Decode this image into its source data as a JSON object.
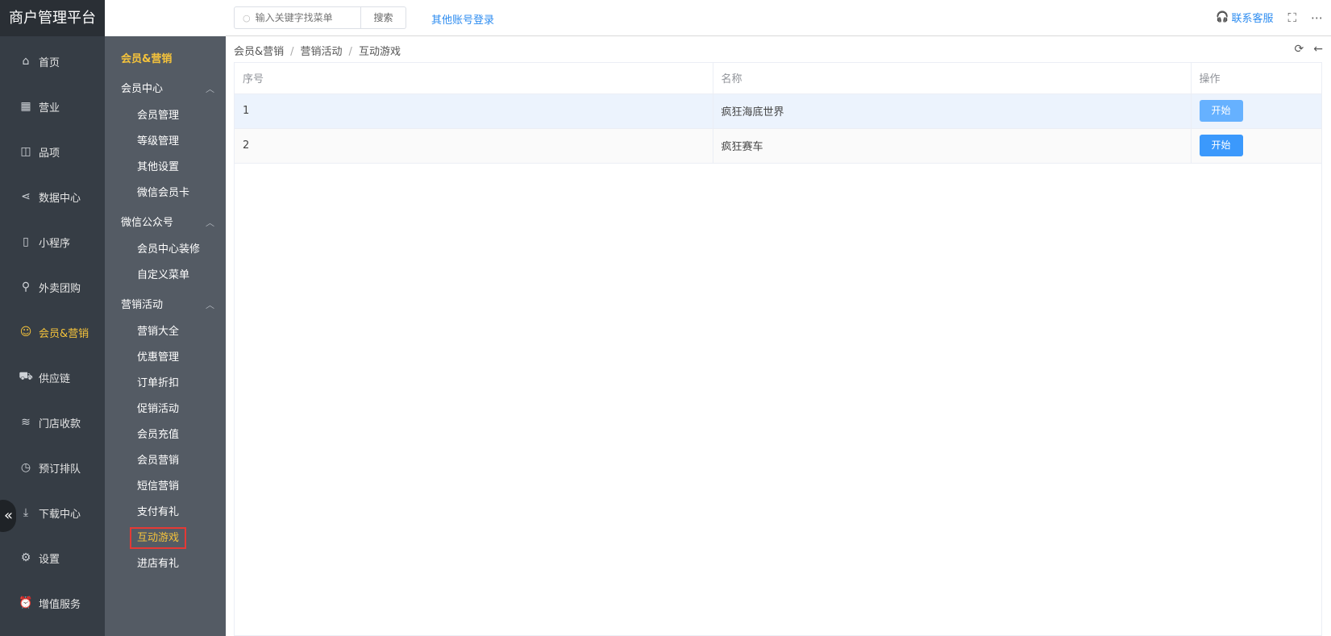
{
  "app": {
    "title": "商户管理平台"
  },
  "topbar": {
    "search_placeholder": "输入关键字找菜单",
    "search_button": "搜索",
    "other_login": "其他账号登录",
    "contact": "联系客服"
  },
  "sidebar": {
    "items": [
      {
        "label": "首页",
        "icon": "home-icon"
      },
      {
        "label": "营业",
        "icon": "calendar-icon"
      },
      {
        "label": "品项",
        "icon": "bag-icon"
      },
      {
        "label": "数据中心",
        "icon": "share-icon"
      },
      {
        "label": "小程序",
        "icon": "phone-icon"
      },
      {
        "label": "外卖团购",
        "icon": "bike-icon"
      },
      {
        "label": "会员&营销",
        "icon": "user-icon",
        "active": true
      },
      {
        "label": "供应链",
        "icon": "truck-icon"
      },
      {
        "label": "门店收款",
        "icon": "database-icon"
      },
      {
        "label": "预订排队",
        "icon": "clock-icon"
      },
      {
        "label": "下载中心",
        "icon": "download-icon"
      },
      {
        "label": "设置",
        "icon": "gear-icon"
      },
      {
        "label": "增值服务",
        "icon": "alarm-icon"
      }
    ],
    "collapse": "«"
  },
  "subnav": {
    "title": "会员&营销",
    "groups": [
      {
        "label": "会员中心",
        "items": [
          "会员管理",
          "等级管理",
          "其他设置",
          "微信会员卡"
        ]
      },
      {
        "label": "微信公众号",
        "items": [
          "会员中心装修",
          "自定义菜单"
        ]
      },
      {
        "label": "营销活动",
        "items": [
          "营销大全",
          "优惠管理",
          "订单折扣",
          "促销活动",
          "会员充值",
          "会员营销",
          "短信营销",
          "支付有礼",
          "互动游戏",
          "进店有礼"
        ]
      }
    ],
    "active": "互动游戏"
  },
  "breadcrumb": [
    "会员&营销",
    "营销活动",
    "互动游戏"
  ],
  "table": {
    "headers": [
      "序号",
      "名称",
      "操作"
    ],
    "rows": [
      {
        "index": "1",
        "name": "疯狂海底世界",
        "action": "开始"
      },
      {
        "index": "2",
        "name": "疯狂赛车",
        "action": "开始"
      }
    ]
  }
}
